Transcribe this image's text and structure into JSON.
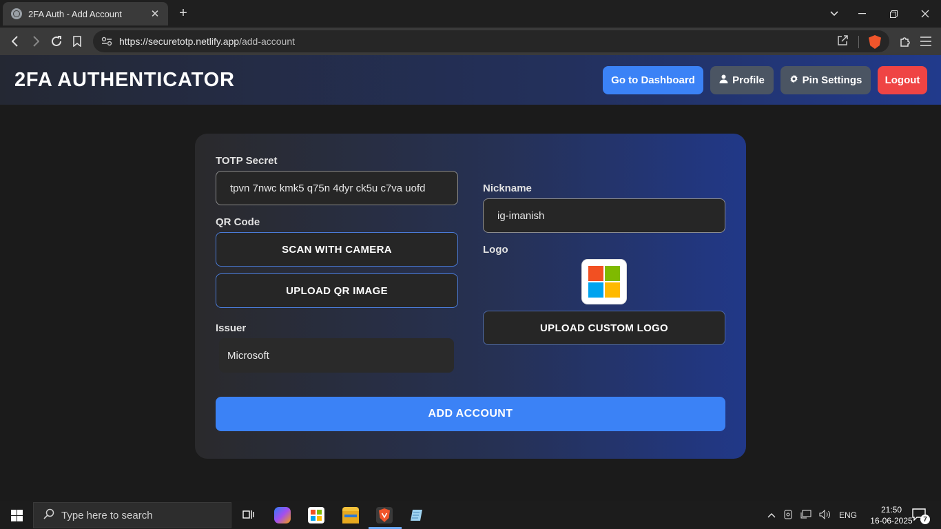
{
  "browser": {
    "tab_title": "2FA Auth - Add Account",
    "tab_close": "✕",
    "new_tab": "+",
    "url_host": "https://securetotp.netlify.app",
    "url_path": "/add-account"
  },
  "header": {
    "title": "2FA AUTHENTICATOR",
    "buttons": {
      "dashboard": "Go to Dashboard",
      "profile": "Profile",
      "pin_settings": "Pin Settings",
      "logout": "Logout"
    }
  },
  "form": {
    "totp_label": "TOTP Secret",
    "totp_value": "tpvn 7nwc kmk5 q75n 4dyr ck5u c7va uofd",
    "qr_label": "QR Code",
    "scan_button": "SCAN WITH CAMERA",
    "upload_qr_button": "UPLOAD QR IMAGE",
    "issuer_label": "Issuer",
    "issuer_value": "Microsoft",
    "nickname_label": "Nickname",
    "nickname_value": "ig-imanish",
    "logo_label": "Logo",
    "upload_logo_button": "UPLOAD CUSTOM LOGO",
    "add_button": "ADD ACCOUNT"
  },
  "taskbar": {
    "search_placeholder": "Type here to search",
    "language": "ENG",
    "time": "21:50",
    "date": "16-06-2025",
    "notification_count": "7"
  },
  "colors": {
    "primary_blue": "#3b82f6",
    "logout_red": "#ef4444",
    "button_gray": "#4b5563"
  }
}
